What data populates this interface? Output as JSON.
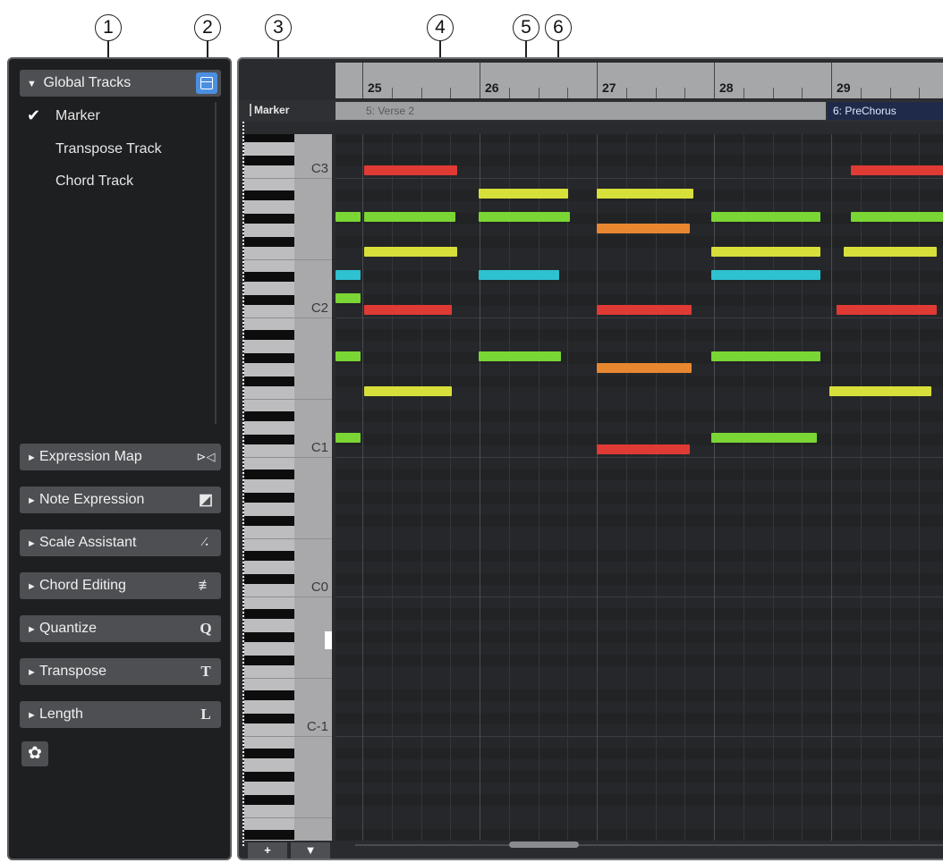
{
  "callouts": [
    "1",
    "2",
    "3",
    "4",
    "5",
    "6"
  ],
  "inspector": {
    "global_tracks": {
      "label": "Global Tracks",
      "arrow": "▼",
      "icon": "track-visibility-icon",
      "items": [
        "Marker",
        "Transpose Track",
        "Chord Track"
      ],
      "checked_mark": "✔"
    },
    "sections": [
      {
        "label": "Expression Map",
        "arrow": "►",
        "icon_glyph": "⊳◁",
        "icon": "expression-map-icon"
      },
      {
        "label": "Note Expression",
        "arrow": "►",
        "icon_glyph": "◩",
        "icon": "note-expression-icon"
      },
      {
        "label": "Scale Assistant",
        "arrow": "►",
        "icon_glyph": "⁄.",
        "icon": "scale-assistant-icon"
      },
      {
        "label": "Chord Editing",
        "arrow": "►",
        "icon_glyph": "≢",
        "icon": "chord-editing-icon"
      },
      {
        "label": "Quantize",
        "arrow": "►",
        "icon_glyph": "Q",
        "icon": "quantize-icon"
      },
      {
        "label": "Transpose",
        "arrow": "►",
        "icon_glyph": "T",
        "icon": "transpose-icon"
      },
      {
        "label": "Length",
        "arrow": "►",
        "icon_glyph": "L",
        "icon": "length-icon"
      }
    ],
    "settings_glyph": "✿"
  },
  "editor": {
    "bars": [
      "25",
      "26",
      "27",
      "28",
      "29"
    ],
    "marker_track_label": "Marker",
    "markers": [
      {
        "label": "5: Verse 2"
      },
      {
        "label": "6: PreChorus"
      }
    ],
    "key_labels": [
      "C3",
      "C2",
      "C1",
      "C0",
      "C-1"
    ],
    "keyboard_buttons": [
      "+",
      "▼"
    ],
    "colors": {
      "red": "#e03a35",
      "green": "#7ad634",
      "yellow": "#d7df3a",
      "orange": "#e98730",
      "cyan": "#2ec1cf"
    }
  }
}
